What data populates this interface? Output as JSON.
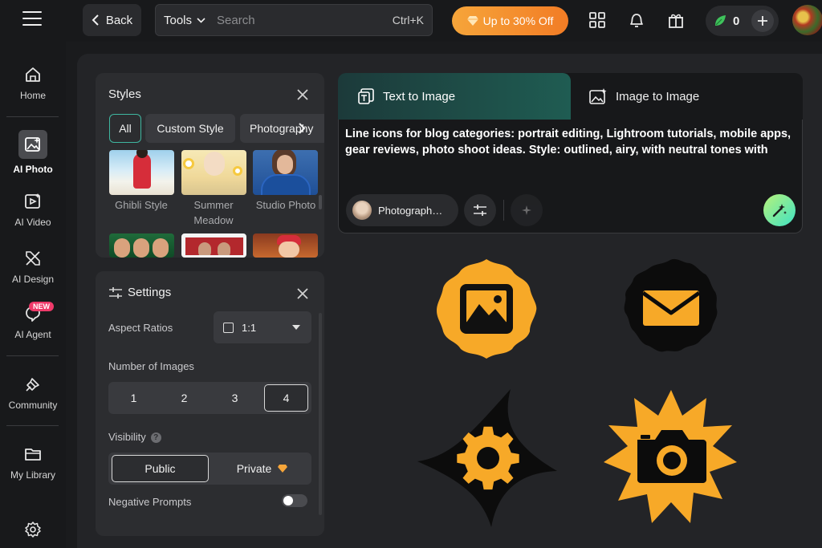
{
  "topbar": {
    "back_label": "Back",
    "tools_label": "Tools",
    "search_placeholder": "Search",
    "search_shortcut": "Ctrl+K",
    "promo_label": "Up to 30% Off",
    "credits_count": "0"
  },
  "nav": {
    "items": [
      {
        "label": "Home",
        "icon": "home-icon"
      },
      {
        "label": "AI Photo",
        "icon": "image-sparkle-icon"
      },
      {
        "label": "AI Video",
        "icon": "video-sparkle-icon"
      },
      {
        "label": "AI Design",
        "icon": "design-tools-icon"
      },
      {
        "label": "AI Agent",
        "icon": "agent-icon",
        "badge": "NEW"
      },
      {
        "label": "Community",
        "icon": "community-icon"
      },
      {
        "label": "My Library",
        "icon": "folder-icon"
      }
    ],
    "settings_icon": "gear-icon"
  },
  "styles": {
    "title": "Styles",
    "chips": [
      "All",
      "Custom Style",
      "Photography"
    ],
    "thumbnails": [
      {
        "label": "Ghibli Style"
      },
      {
        "label": "Summer Meadow"
      },
      {
        "label": "Studio Photo"
      }
    ]
  },
  "settings": {
    "title": "Settings",
    "aspect_label": "Aspect Ratios",
    "aspect_value": "1:1",
    "images_label": "Number of Images",
    "image_counts": [
      "1",
      "2",
      "3",
      "4"
    ],
    "selected_count": "4",
    "visibility_label": "Visibility",
    "visibility_options": [
      "Public",
      "Private"
    ],
    "selected_visibility": "Public",
    "negative_label": "Negative Prompts",
    "negative_enabled": false
  },
  "prompt": {
    "tab_text_to_image": "Text to Image",
    "tab_image_to_image": "Image to Image",
    "text": "Line icons for blog categories: portrait editing, Lightroom tutorials, mobile apps, gear reviews, photo shoot ideas. Style: outlined, airy, with neutral tones with",
    "style_pill": "Photograph…"
  },
  "results": [
    {
      "icon": "image-icon",
      "shape": "wavy-octagon"
    },
    {
      "icon": "mail-icon",
      "shape": "scalloped-circle"
    },
    {
      "icon": "gear-icon",
      "shape": "four-point-star"
    },
    {
      "icon": "camera-icon",
      "shape": "starburst"
    }
  ],
  "colors": {
    "accent_orange": "#F7A928",
    "accent_teal": "#3FB6A0",
    "promo_orange": "#F27C25",
    "new_badge": "#EF3A6A"
  }
}
